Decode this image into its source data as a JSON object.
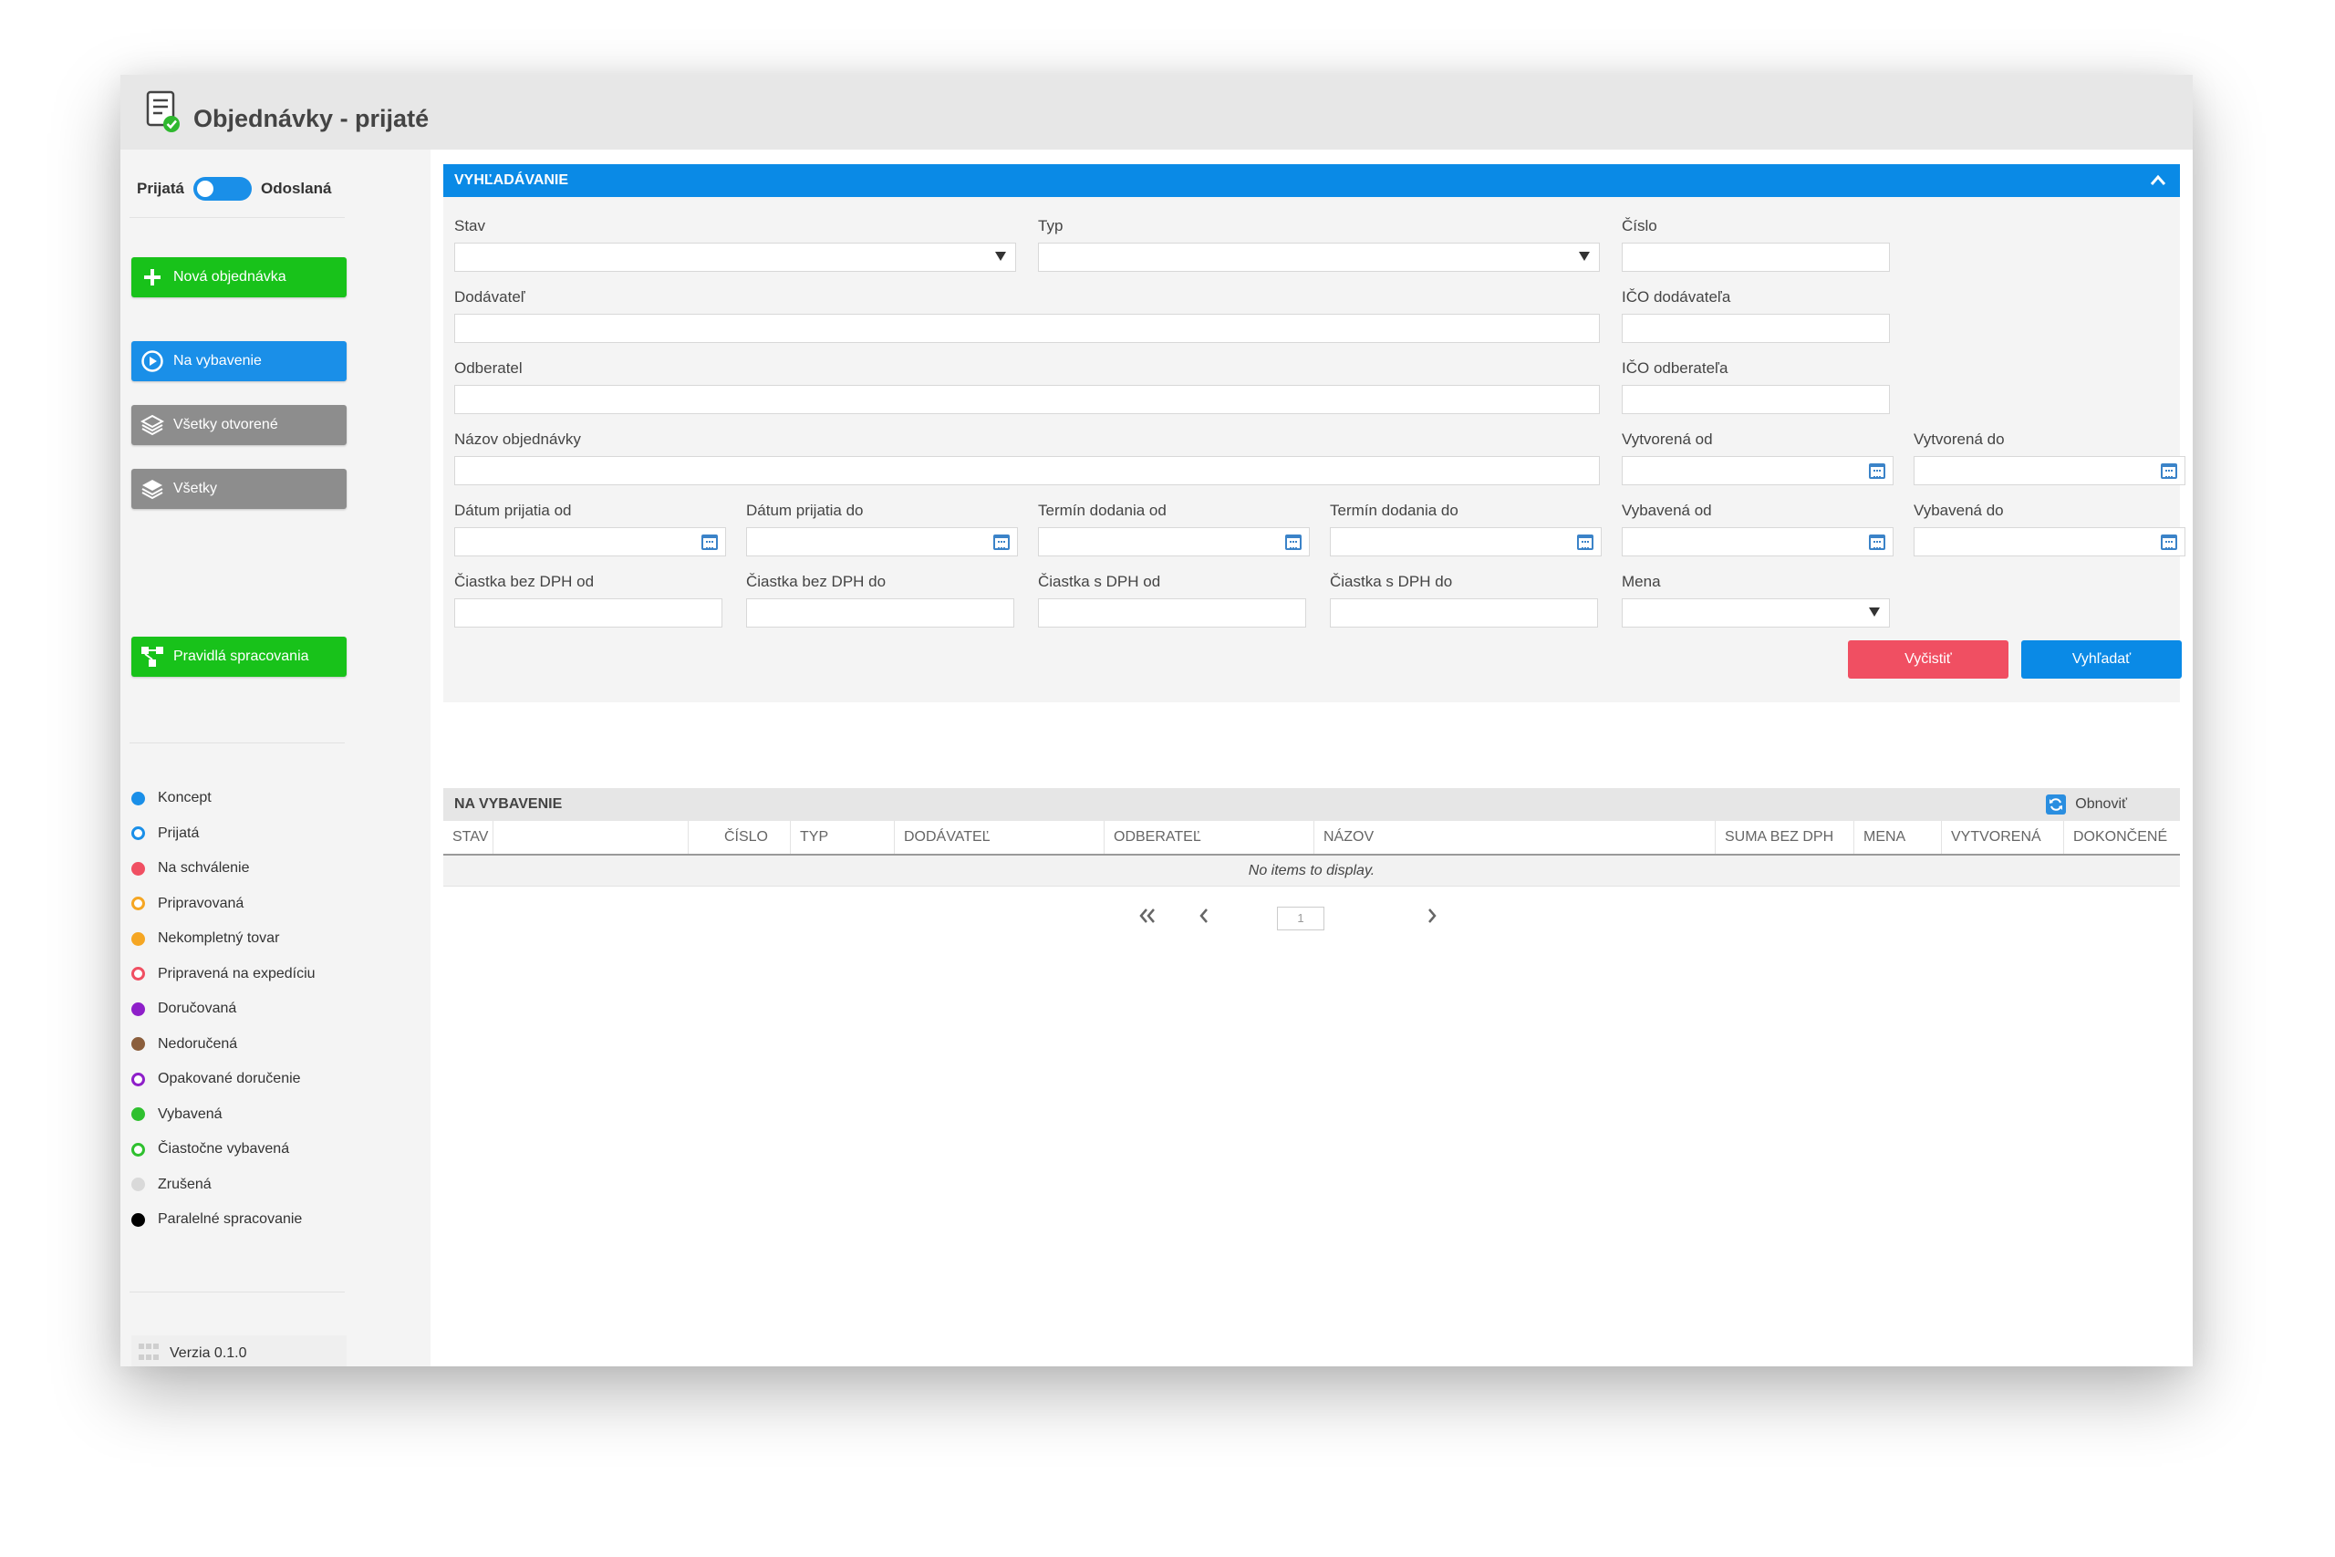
{
  "app": {
    "title": "Objednávky - prijaté"
  },
  "sidebar": {
    "toggle_left": "Prijatá",
    "toggle_right": "Odoslaná",
    "buttons": {
      "new_order": "Nová objednávka",
      "to_process": "Na vybavenie",
      "all_open": "Všetky otvorené",
      "all": "Všetky",
      "rules": "Pravidlá spracovania"
    },
    "legend": [
      {
        "label": "Koncept",
        "color": "#1a8fe8",
        "filled": true
      },
      {
        "label": "Prijatá",
        "color": "#1a8fe8",
        "filled": false
      },
      {
        "label": "Na schválenie",
        "color": "#f04f62",
        "filled": true
      },
      {
        "label": "Pripravovaná",
        "color": "#f5a623",
        "filled": false
      },
      {
        "label": "Nekompletný tovar",
        "color": "#f5a623",
        "filled": true
      },
      {
        "label": "Pripravená na expedíciu",
        "color": "#f04f62",
        "filled": false
      },
      {
        "label": "Doručovaná",
        "color": "#8e1fc9",
        "filled": true
      },
      {
        "label": "Nedoručená",
        "color": "#8b5e3c",
        "filled": true
      },
      {
        "label": "Opakované doručenie",
        "color": "#8e1fc9",
        "filled": false
      },
      {
        "label": "Vybavená",
        "color": "#2fc02f",
        "filled": true
      },
      {
        "label": "Čiastočne vybavená",
        "color": "#2fc02f",
        "filled": false
      },
      {
        "label": "Zrušená",
        "color": "#d9d9d9",
        "filled": true
      },
      {
        "label": "Paralelné spracovanie",
        "color": "#000000",
        "filled": true
      }
    ],
    "version": "Verzia 0.1.0"
  },
  "search": {
    "title": "VYHĽADÁVANIE",
    "labels": {
      "stav": "Stav",
      "typ": "Typ",
      "cislo": "Číslo",
      "dodavatel": "Dodávateľ",
      "ico_dodavatela": "IČO dodávateľa",
      "odberatel": "Odberatel",
      "ico_odberatela": "IČO odberateľa",
      "nazov": "Názov objednávky",
      "vytvorena_od": "Vytvorená od",
      "vytvorena_do": "Vytvorená do",
      "datum_prijatia_od": "Dátum prijatia od",
      "datum_prijatia_do": "Dátum prijatia do",
      "termin_dodania_od": "Termín dodania od",
      "termin_dodania_do": "Termín dodania do",
      "vybavena_od": "Vybavená od",
      "vybavena_do": "Vybavená do",
      "ciastka_bez_od": "Čiastka bez DPH od",
      "ciastka_bez_do": "Čiastka bez DPH do",
      "ciastka_s_od": "Čiastka s DPH od",
      "ciastka_s_do": "Čiastka s DPH do",
      "mena": "Mena"
    },
    "clear_label": "Vyčistiť",
    "search_label": "Vyhľadať"
  },
  "list": {
    "title": "NA VYBAVENIE",
    "refresh_label": "Obnoviť",
    "columns": [
      "STAV",
      "ČÍSLO",
      "TYP",
      "DODÁVATEĽ",
      "ODBERATEĽ",
      "NÁZOV",
      "SUMA BEZ DPH",
      "MENA",
      "VYTVORENÁ",
      "DOKONČENÉ"
    ],
    "empty_text": "No items to display.",
    "page": "1"
  }
}
